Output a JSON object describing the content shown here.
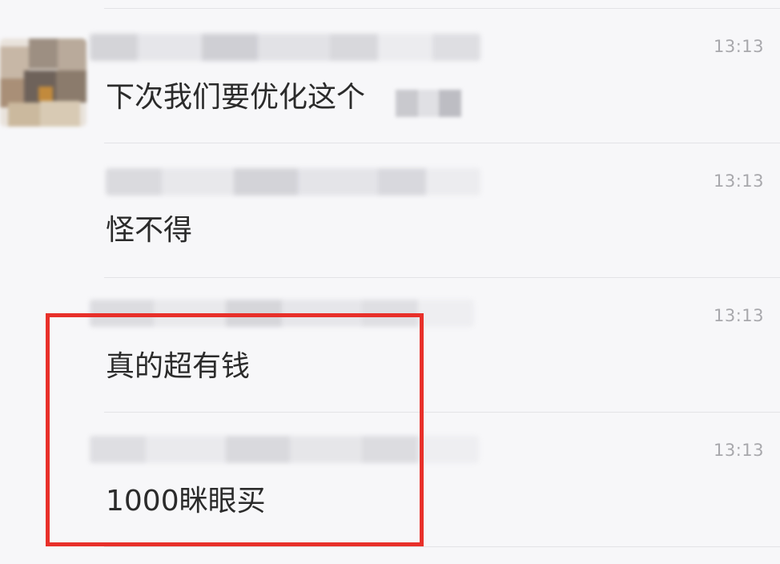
{
  "messages": [
    {
      "text": "下次我们要优化这个",
      "time": "13:13"
    },
    {
      "text": "怪不得",
      "time": "13:13"
    },
    {
      "text": "真的超有钱",
      "time": "13:13"
    },
    {
      "text": "1000眯眼买",
      "time": "13:13"
    }
  ],
  "colors": {
    "background": "#f7f7f9",
    "divider": "#e3e3e6",
    "message_text": "#2b2b2b",
    "time_text": "#a8a8ac",
    "highlight": "#e8302a"
  }
}
